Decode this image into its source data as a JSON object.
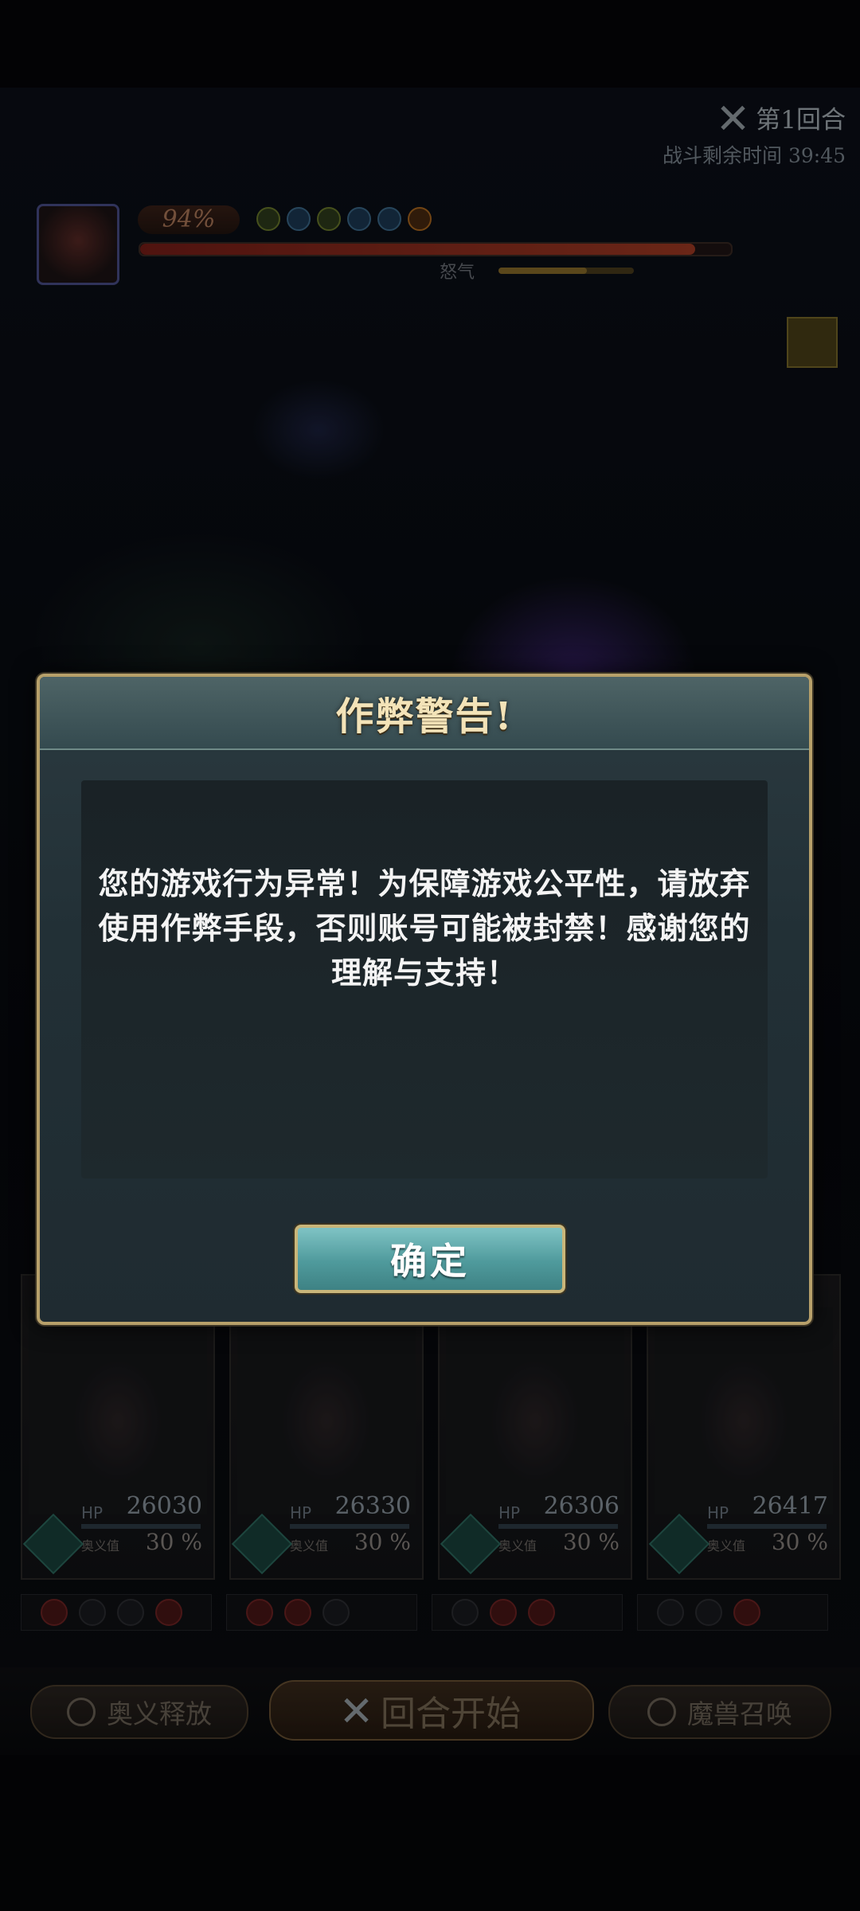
{
  "hud": {
    "round_label": "第1回合",
    "time_label": "战斗剩余时间",
    "time_value": "39:45",
    "boss_hp_percent": "94%",
    "boss_hp_fraction": 0.94,
    "rage_label": "怒气",
    "rage_fraction": 0.65
  },
  "cards": [
    {
      "hp_label": "HP",
      "hp_value": "26030",
      "skill_label": "奥义值",
      "skill_percent": "30",
      "skill_unit": "%"
    },
    {
      "hp_label": "HP",
      "hp_value": "26330",
      "skill_label": "奥义值",
      "skill_percent": "30",
      "skill_unit": "%"
    },
    {
      "hp_label": "HP",
      "hp_value": "26306",
      "skill_label": "奥义值",
      "skill_percent": "30",
      "skill_unit": "%"
    },
    {
      "hp_label": "HP",
      "hp_value": "26417",
      "skill_label": "奥义值",
      "skill_percent": "30",
      "skill_unit": "%"
    }
  ],
  "bottom_bar": {
    "left_label": "奥义释放",
    "center_label": "回合开始",
    "right_label": "魔兽召唤"
  },
  "dialog": {
    "title": "作弊警告!",
    "message": "您的游戏行为异常！为保障游戏公平性，请放弃使用作弊手段，否则账号可能被封禁！感谢您的理解与支持！",
    "confirm_label": "确定"
  },
  "colors": {
    "dialog_border": "#b7a06a",
    "confirm_button": "#5fa8aa",
    "title_text": "#f3e3b8"
  }
}
